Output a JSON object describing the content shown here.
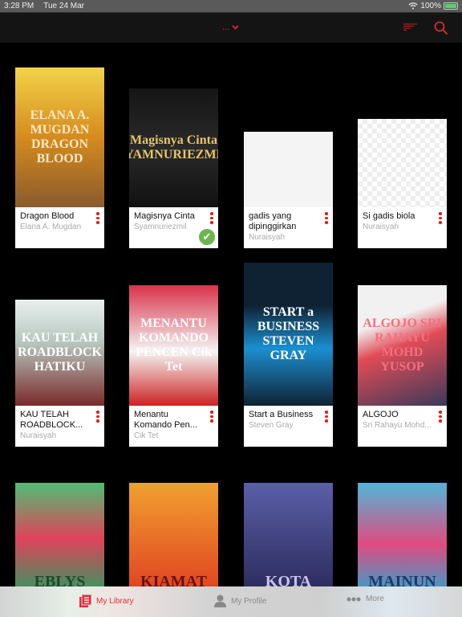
{
  "status": {
    "time": "3:28 PM",
    "date": "Tue 24 Mar",
    "battery": "100%"
  },
  "nav": {
    "title": "...",
    "colors": {
      "accent": "#e53030"
    }
  },
  "books": [
    {
      "title": "Dragon Blood",
      "author": "Elana A. Mugdan",
      "cover_text": "ELANA A. MUGDAN DRAGON BLOOD",
      "bg": "linear-gradient(180deg,#f3d34a,#d58b1e 50%,#8a5b2e)",
      "fg": "#f7e9c4"
    },
    {
      "title": "Magisnya Cinta",
      "author": "Syamnuriezmil",
      "cover_text": "Magisnya Cinta SYAMNURIEZMIL",
      "bg": "linear-gradient(180deg,#151515,#2a2a2a 50%,#111)",
      "fg": "#e6c46a",
      "downloaded": true
    },
    {
      "title": "gadis yang dipinggirkan",
      "author": "Nuraisyah",
      "cover_text": "",
      "bg": "#f4f4f4",
      "fg": "#333"
    },
    {
      "title": "Si gadis biola",
      "author": "Nuraisyah",
      "cover_text": "",
      "bg": "repeating-conic-gradient(#eee 0 25%,#fff 0 50%) 0 0/12px 12px",
      "fg": "#8a3b12"
    },
    {
      "title": "KAU TELAH ROADBLOCK...",
      "author": "Nuraisyah",
      "cover_text": "KAU TELAH ROADBLOCK HATIKU",
      "bg": "linear-gradient(180deg,#e8f0ee,#b7c7c0 40%,#7a2a2a)",
      "fg": "#fff"
    },
    {
      "title": "Menantu Komando Pen...",
      "author": "Cik Tet",
      "cover_text": "MENANTU KOMANDO PENCEN Cik Tet",
      "bg": "linear-gradient(180deg,#d8334a,#f4f4f4 55%,#c22)",
      "fg": "#fff"
    },
    {
      "title": "Start a Business",
      "author": "Steven Gray",
      "cover_text": "START a BUSINESS STEVEN GRAY",
      "bg": "linear-gradient(180deg,#0f2233 30%,#1b8fd1 60%,#0f2233)",
      "fg": "#fff"
    },
    {
      "title": "ALGOJO",
      "author": "Sri Rahayu Mohd...",
      "cover_text": "ALGOJO SRI RAHAYU MOHD YUSOP",
      "bg": "linear-gradient(160deg,#f1f1f1 30%,#e04b56 50%,#3a3a5a)",
      "fg": "#f37080"
    },
    {
      "title": "",
      "author": "",
      "cover_text": "EBLYS",
      "bg": "linear-gradient(180deg,#4fbf73,#e0435b 50%,#2f9a5f)",
      "fg": "#1d4a2a"
    },
    {
      "title": "",
      "author": "",
      "cover_text": "KIAMAT",
      "bg": "linear-gradient(180deg,#f0a030,#e04020)",
      "fg": "#6a1010"
    },
    {
      "title": "",
      "author": "",
      "cover_text": "KOTA",
      "bg": "linear-gradient(180deg,#5b5fa8,#2a2a5a)",
      "fg": "#c9c2ec"
    },
    {
      "title": "",
      "author": "",
      "cover_text": "MAINUN",
      "bg": "linear-gradient(180deg,#4fb6d9,#e04b80 55%,#2fa2cc)",
      "fg": "#1b3a6a"
    }
  ],
  "tabbar": {
    "tabs": [
      {
        "label": "My Library",
        "active": true
      },
      {
        "label": "My Profile"
      },
      {
        "label": "More"
      }
    ]
  }
}
